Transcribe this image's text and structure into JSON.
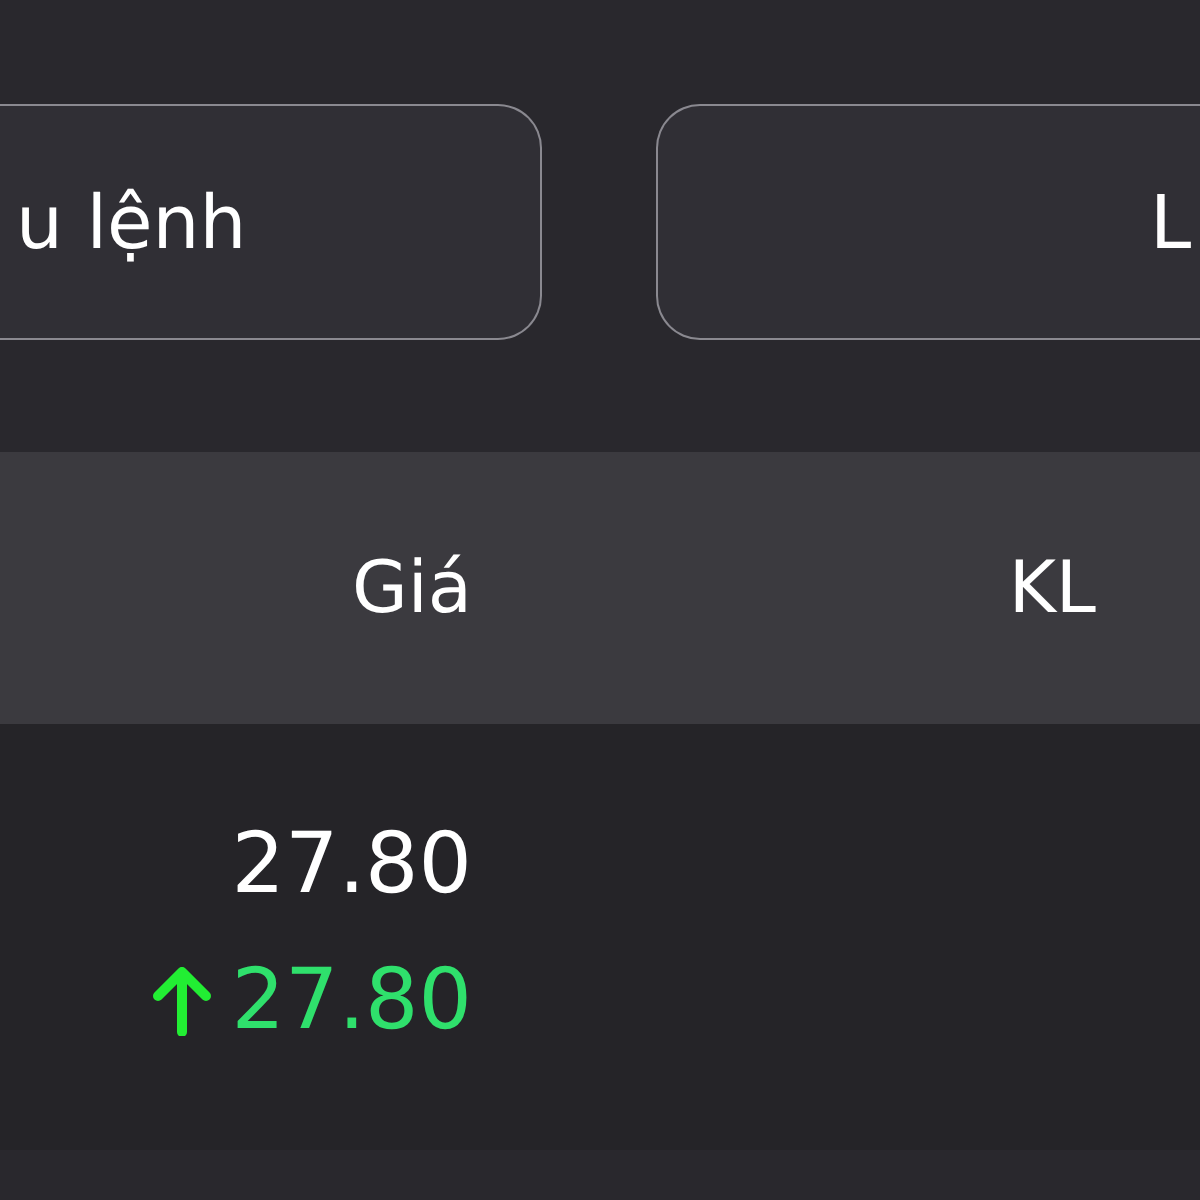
{
  "buttons": [
    {
      "label": "u lệnh"
    },
    {
      "label": "L"
    }
  ],
  "table": {
    "columns": [
      {
        "label": "Giá"
      },
      {
        "label": "KL"
      }
    ],
    "rows": [
      {
        "price": "27.80",
        "match_price": "27.80",
        "rising": true
      }
    ]
  }
}
